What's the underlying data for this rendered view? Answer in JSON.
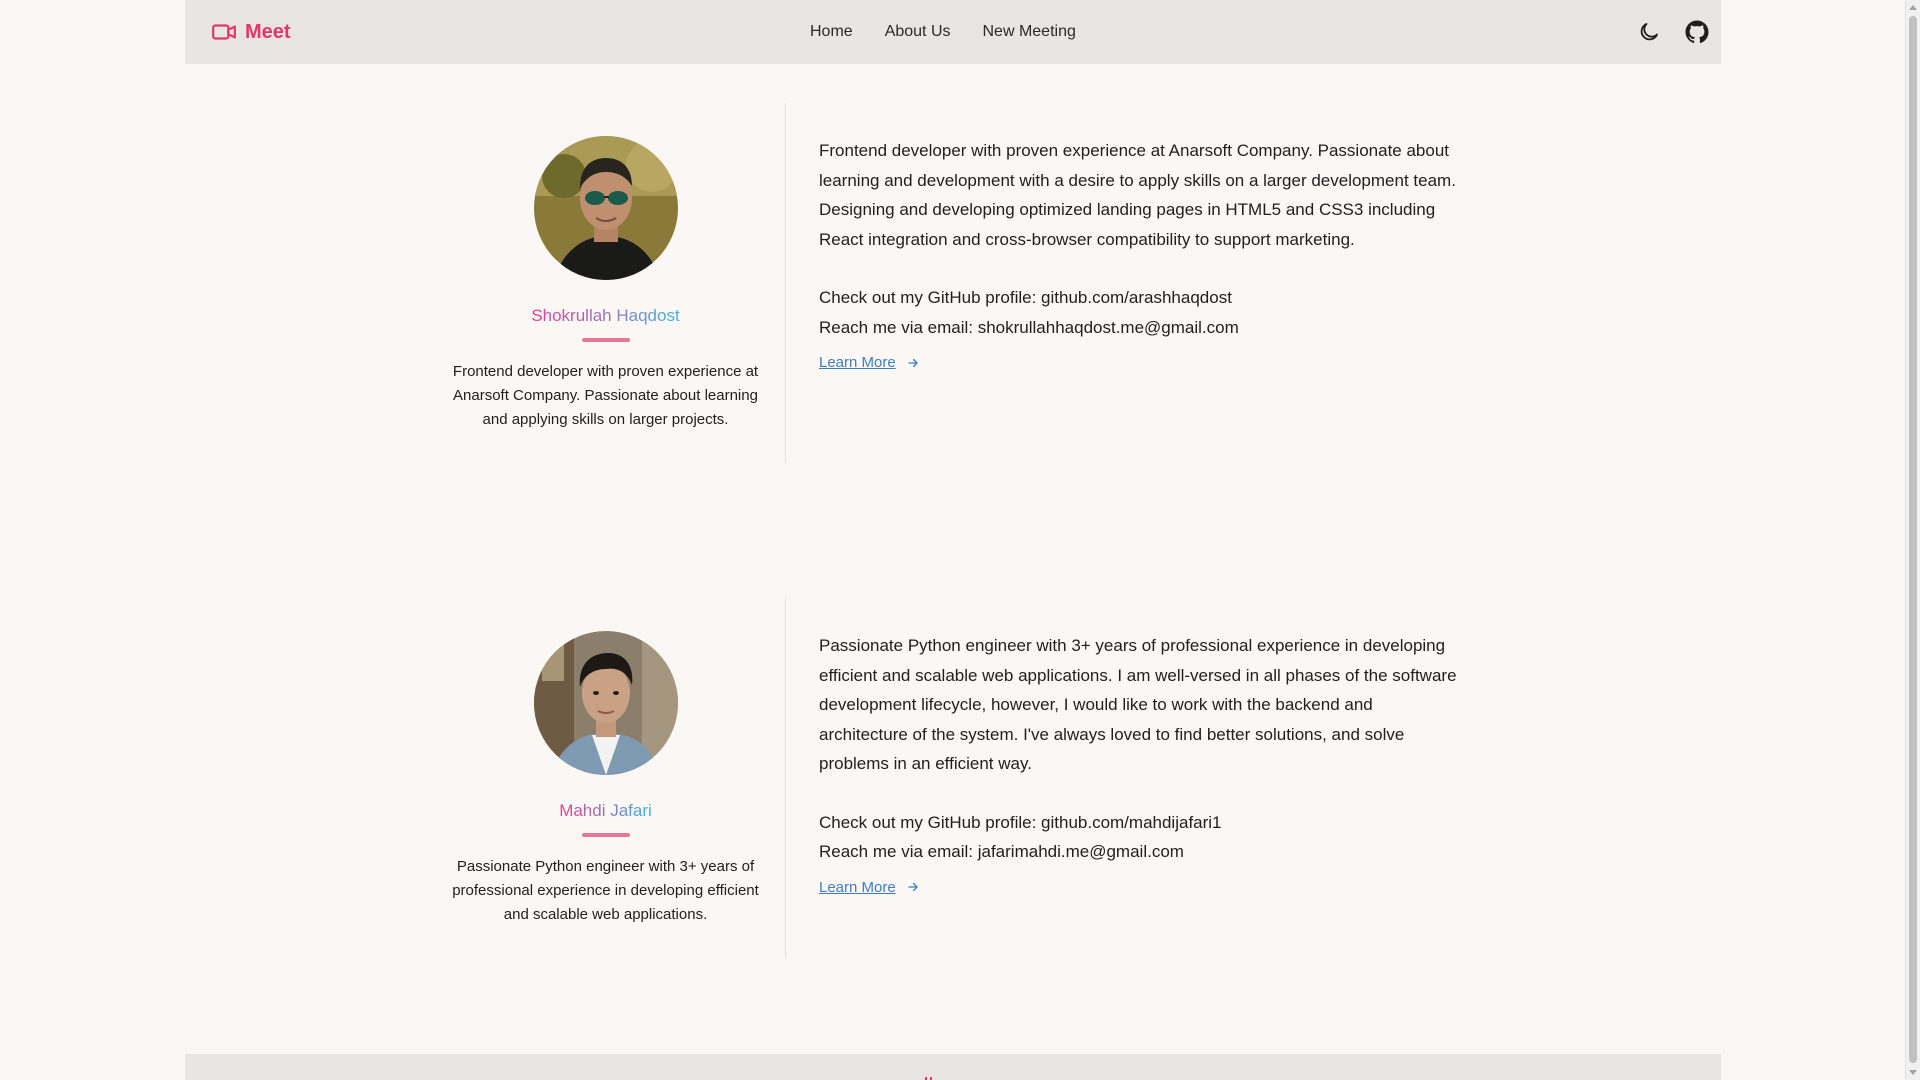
{
  "header": {
    "brand": "Meet",
    "nav": [
      "Home",
      "About Us",
      "New Meeting"
    ],
    "icons": [
      "moon-icon",
      "github-icon"
    ],
    "accent_color": "#e5356f"
  },
  "profiles": [
    {
      "name": "Shokrullah Haqdost",
      "short_bio": "Frontend developer with proven experience at Anarsoft Company. Passionate about learning and applying skills on larger projects.",
      "long_bio": "Frontend developer with proven experience at Anarsoft Company. Passionate about learning and development with a desire to apply skills on a larger development team. Designing and developing optimized landing pages in HTML5 and CSS3 including React integration and cross-browser compatibility to support marketing.",
      "github_line": "Check out my GitHub profile: github.com/arashhaqdost",
      "email_line": "Reach me via email: shokrullahhaqdost.me@gmail.com",
      "learn_more": "Learn More"
    },
    {
      "name": "Mahdi Jafari",
      "short_bio": "Passionate Python engineer with 3+ years of professional experience in developing efficient and scalable web applications.",
      "long_bio": "Passionate Python engineer with 3+ years of professional experience in developing efficient and scalable web applications. I am well-versed in all phases of the software development lifecycle, however, I would like to work with the backend and architecture of the system. I've always loved to find better solutions, and solve problems in an efficient way.",
      "github_line": "Check out my GitHub profile: github.com/mahdijafari1",
      "email_line": "Reach me via email: jafarimahdi.me@gmail.com",
      "learn_more": "Learn More"
    }
  ],
  "colors": {
    "name_gradient_start": "#ec3a8c",
    "name_gradient_end": "#3ab4e6",
    "link": "#3f7cc4"
  }
}
